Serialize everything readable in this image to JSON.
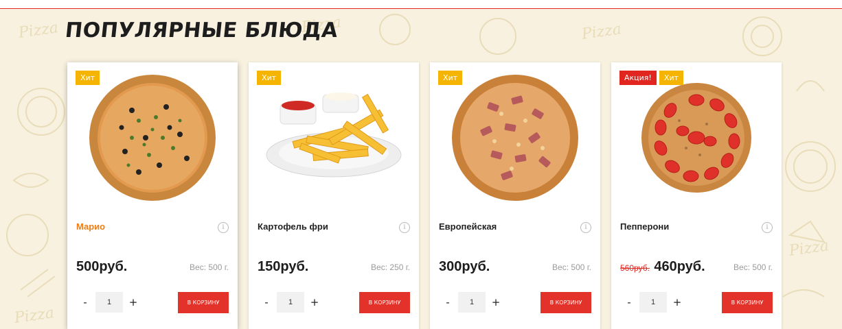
{
  "section": {
    "title": "ПОПУЛЯРНЫЕ БЛЮДА"
  },
  "background": {
    "doodle_text": "Pizza"
  },
  "colors": {
    "accent": "#e0261f",
    "hit_badge": "#f5b400",
    "active_name": "#ef7d14",
    "background": "#f8f1e0"
  },
  "icons": {
    "info": "info-circle-icon",
    "minus": "minus-icon",
    "plus": "plus-icon"
  },
  "products": [
    {
      "name": "Марио",
      "price": "500руб.",
      "weight": "Вес: 500 г.",
      "quantity": "1",
      "cart_label": "В КОРЗИНУ",
      "badges": [
        "Хит"
      ]
    },
    {
      "name": "Картофель фри",
      "price": "150руб.",
      "weight": "Вес: 250 г.",
      "quantity": "1",
      "cart_label": "В КОРЗИНУ",
      "badges": [
        "Хит"
      ]
    },
    {
      "name": "Европейская",
      "price": "300руб.",
      "weight": "Вес: 500 г.",
      "quantity": "1",
      "cart_label": "В КОРЗИНУ",
      "badges": [
        "Хит"
      ]
    },
    {
      "name": "Пепперони",
      "old_price": "560руб.",
      "price": "460руб.",
      "weight": "Вес: 500 г.",
      "quantity": "1",
      "cart_label": "В КОРЗИНУ",
      "badges": [
        "Акция!",
        "Хит"
      ]
    }
  ]
}
